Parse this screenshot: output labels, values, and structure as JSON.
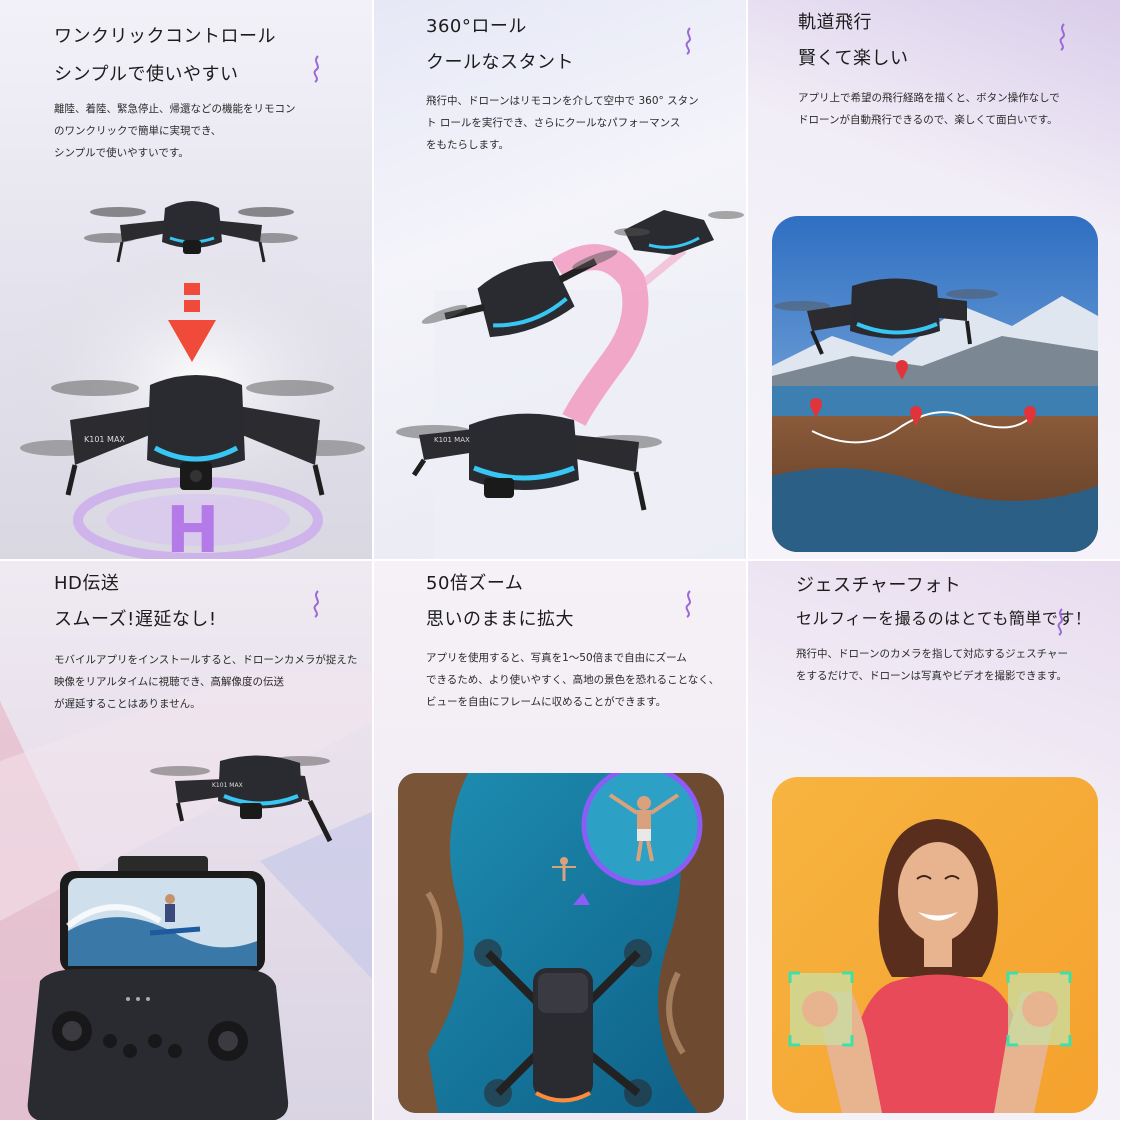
{
  "panels": [
    {
      "title1": "ワンクリックコントロール",
      "title2": "シンプルで使いやすい",
      "desc": "離陸、着陸、緊急停止、帰還などの機能をリモコン\nのワンクリックで簡単に実現でき、\nシンプルで使いやすいです。",
      "drone_label": "K101 MAX",
      "pad_letter": "H"
    },
    {
      "title1": "360°ロール",
      "title2": "クールなスタント",
      "desc": "飛行中、ドローンはリモコンを介して空中で 360° スタン\nト ロールを実行でき、さらにクールなパフォーマンス\nをもたらします。",
      "drone_label": "K101 MAX"
    },
    {
      "title1": "軌道飛行",
      "title2": "賢くて楽しい",
      "desc": "アプリ上で希望の飛行経路を描くと、ボタン操作なしで\nドローンが自動飛行できるので、楽しくて面白いです。"
    },
    {
      "title1": "HD伝送",
      "title2": "スムーズ!遅延なし!",
      "desc": "モバイルアプリをインストールすると、ドローンカメラが捉えた\n映像をリアルタイムに視聴でき、高解像度の伝送\nが遅延することはありません。",
      "drone_label": "K101 MAX"
    },
    {
      "title1": "50倍ズーム",
      "title2": "思いのままに拡大",
      "desc": "アプリを使用すると、写真を1～50倍まで自由にズーム\nできるため、より使いやすく、高地の景色を恐れることなく、\nビューを自由にフレームに収めることができます。"
    },
    {
      "title1": "ジェスチャーフォト",
      "title2": "セルフィーを撮るのはとても簡単です！",
      "desc": "飛行中、ドローンのカメラを指して対応するジェスチャー\nをするだけで、ドローンは写真やビデオを撮影できます。"
    }
  ],
  "colors": {
    "accent_purple": "#8b5cf6",
    "squiggle": "#9b6ad6",
    "glow_blue": "#38c6f4",
    "pin_red": "#e0343a",
    "arrow_red": "#f04a3a",
    "gesture_frame": "#3fe0a8"
  }
}
